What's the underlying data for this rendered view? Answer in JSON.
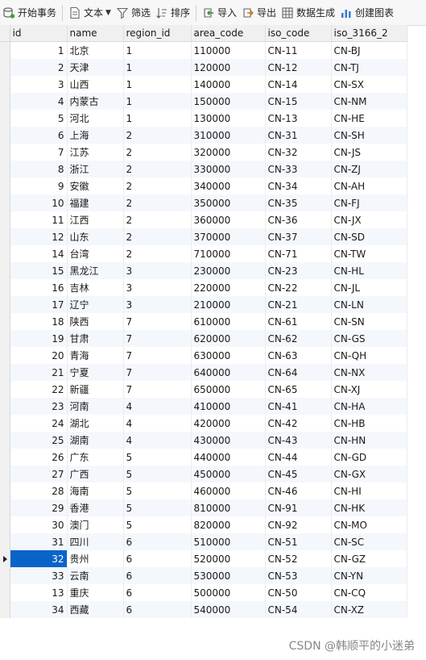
{
  "toolbar": {
    "begin_transaction": "开始事务",
    "text": "文本",
    "filter": "筛选",
    "sort": "排序",
    "import": "导入",
    "export": "导出",
    "data_generation": "数据生成",
    "create_chart": "创建图表"
  },
  "grid": {
    "columns": [
      "id",
      "name",
      "region_id",
      "area_code",
      "iso_code",
      "iso_3166_2"
    ],
    "selected_row_index": 30,
    "rows": [
      [
        "1",
        "北京",
        "1",
        "110000",
        "CN-11",
        "CN-BJ"
      ],
      [
        "2",
        "天津",
        "1",
        "120000",
        "CN-12",
        "CN-TJ"
      ],
      [
        "3",
        "山西",
        "1",
        "140000",
        "CN-14",
        "CN-SX"
      ],
      [
        "4",
        "内蒙古",
        "1",
        "150000",
        "CN-15",
        "CN-NM"
      ],
      [
        "5",
        "河北",
        "1",
        "130000",
        "CN-13",
        "CN-HE"
      ],
      [
        "6",
        "上海",
        "2",
        "310000",
        "CN-31",
        "CN-SH"
      ],
      [
        "7",
        "江苏",
        "2",
        "320000",
        "CN-32",
        "CN-JS"
      ],
      [
        "8",
        "浙江",
        "2",
        "330000",
        "CN-33",
        "CN-ZJ"
      ],
      [
        "9",
        "安徽",
        "2",
        "340000",
        "CN-34",
        "CN-AH"
      ],
      [
        "10",
        "福建",
        "2",
        "350000",
        "CN-35",
        "CN-FJ"
      ],
      [
        "11",
        "江西",
        "2",
        "360000",
        "CN-36",
        "CN-JX"
      ],
      [
        "12",
        "山东",
        "2",
        "370000",
        "CN-37",
        "CN-SD"
      ],
      [
        "14",
        "台湾",
        "2",
        "710000",
        "CN-71",
        "CN-TW"
      ],
      [
        "15",
        "黑龙江",
        "3",
        "230000",
        "CN-23",
        "CN-HL"
      ],
      [
        "16",
        "吉林",
        "3",
        "220000",
        "CN-22",
        "CN-JL"
      ],
      [
        "17",
        "辽宁",
        "3",
        "210000",
        "CN-21",
        "CN-LN"
      ],
      [
        "18",
        "陕西",
        "7",
        "610000",
        "CN-61",
        "CN-SN"
      ],
      [
        "19",
        "甘肃",
        "7",
        "620000",
        "CN-62",
        "CN-GS"
      ],
      [
        "20",
        "青海",
        "7",
        "630000",
        "CN-63",
        "CN-QH"
      ],
      [
        "21",
        "宁夏",
        "7",
        "640000",
        "CN-64",
        "CN-NX"
      ],
      [
        "22",
        "新疆",
        "7",
        "650000",
        "CN-65",
        "CN-XJ"
      ],
      [
        "23",
        "河南",
        "4",
        "410000",
        "CN-41",
        "CN-HA"
      ],
      [
        "24",
        "湖北",
        "4",
        "420000",
        "CN-42",
        "CN-HB"
      ],
      [
        "25",
        "湖南",
        "4",
        "430000",
        "CN-43",
        "CN-HN"
      ],
      [
        "26",
        "广东",
        "5",
        "440000",
        "CN-44",
        "CN-GD"
      ],
      [
        "27",
        "广西",
        "5",
        "450000",
        "CN-45",
        "CN-GX"
      ],
      [
        "28",
        "海南",
        "5",
        "460000",
        "CN-46",
        "CN-HI"
      ],
      [
        "29",
        "香港",
        "5",
        "810000",
        "CN-91",
        "CN-HK"
      ],
      [
        "30",
        "澳门",
        "5",
        "820000",
        "CN-92",
        "CN-MO"
      ],
      [
        "31",
        "四川",
        "6",
        "510000",
        "CN-51",
        "CN-SC"
      ],
      [
        "32",
        "贵州",
        "6",
        "520000",
        "CN-52",
        "CN-GZ"
      ],
      [
        "33",
        "云南",
        "6",
        "530000",
        "CN-53",
        "CN-YN"
      ],
      [
        "13",
        "重庆",
        "6",
        "500000",
        "CN-50",
        "CN-CQ"
      ],
      [
        "34",
        "西藏",
        "6",
        "540000",
        "CN-54",
        "CN-XZ"
      ]
    ]
  },
  "watermark": "CSDN @韩顺平的小迷弟",
  "colors": {
    "selection": "#0a64c8",
    "alt_row": "#f4f8fd",
    "toolbar_bg": "#f7f7f7"
  }
}
